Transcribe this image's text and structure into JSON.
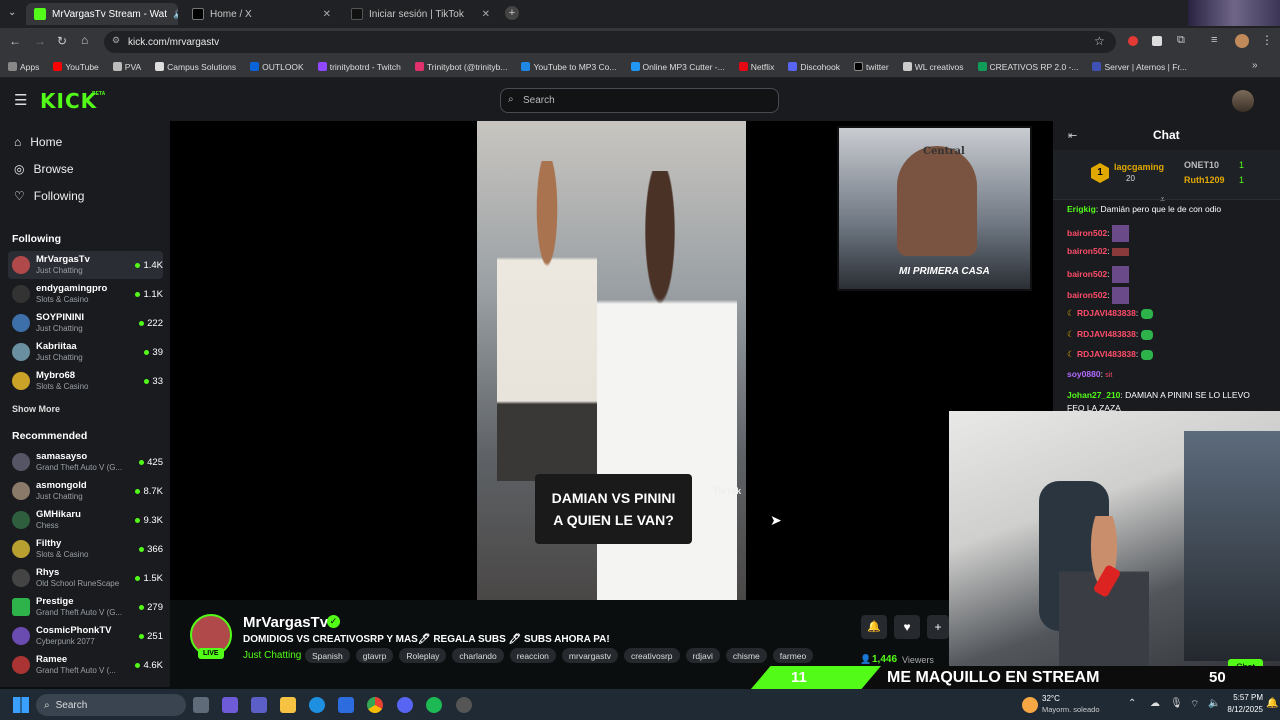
{
  "browser": {
    "tabs": [
      {
        "title": "MrVargasTv Stream - Wat",
        "active": true
      },
      {
        "title": "Home / X",
        "active": false
      },
      {
        "title": "Iniciar sesión | TikTok",
        "active": false
      }
    ],
    "url": "kick.com/mrvargastv",
    "bookmarks": [
      "Apps",
      "YouTube",
      "PVA",
      "Campus Solutions",
      "OUTLOOK",
      "trinitybotrd - Twitch",
      "Trinitybot (@trinityb...",
      "YouTube to MP3 Co...",
      "Online MP3 Cutter -...",
      "Netflix",
      "Discohook",
      "twitter",
      "WL creativos",
      "CREATIVOS RP 2.0 -...",
      "Server | Aternos | Fr..."
    ]
  },
  "header": {
    "logo": "KICK",
    "logo_tag": "BETA",
    "search_placeholder": "Search"
  },
  "sidebar": {
    "nav": [
      "Home",
      "Browse",
      "Following"
    ],
    "following_title": "Following",
    "following": [
      {
        "name": "MrVargasTv",
        "category": "Just Chatting",
        "viewers": "1.4K"
      },
      {
        "name": "endygamingpro",
        "category": "Slots & Casino",
        "viewers": "1.1K"
      },
      {
        "name": "SOYPININI",
        "category": "Just Chatting",
        "viewers": "222"
      },
      {
        "name": "Kabriitaa",
        "category": "Just Chatting",
        "viewers": "39"
      },
      {
        "name": "Mybro68",
        "category": "Slots & Casino",
        "viewers": "33"
      }
    ],
    "show_more": "Show More",
    "recommended_title": "Recommended",
    "recommended": [
      {
        "name": "samasayso",
        "category": "Grand Theft Auto V (G...",
        "viewers": "425"
      },
      {
        "name": "asmongold",
        "category": "Just Chatting",
        "viewers": "8.7K"
      },
      {
        "name": "GMHikaru",
        "category": "Chess",
        "viewers": "9.3K"
      },
      {
        "name": "Filthy",
        "category": "Slots & Casino",
        "viewers": "366"
      },
      {
        "name": "Rhys",
        "category": "Old School RuneScape",
        "viewers": "1.5K"
      },
      {
        "name": "Prestige",
        "category": "Grand Theft Auto V (G...",
        "viewers": "279"
      },
      {
        "name": "CosmicPhonkTV",
        "category": "Cyberpunk 2077",
        "viewers": "251"
      },
      {
        "name": "Ramee",
        "category": "Grand Theft Auto V (...",
        "viewers": "4.6K"
      }
    ]
  },
  "video": {
    "caption_line1": "DAMIAN VS PININI",
    "caption_line2": "A QUIEN LE VAN?",
    "watermark": "TikTok",
    "cam_sign": "Central",
    "cam_banner": "MI PRIMERA CASA"
  },
  "stream": {
    "streamer": "MrVargasTv",
    "live_badge": "LIVE",
    "title": "DOMIDIOS VS CREATIVOSRP Y MAS🖊 REGALA SUBS 🖊 SUBS AHORA PA!",
    "category": "Just Chatting",
    "tags": [
      "Spanish",
      "gtavrp",
      "Roleplay",
      "charlando",
      "reaccion",
      "mrvargastv",
      "creativosrp",
      "rdjavi",
      "chisme",
      "farmeo"
    ],
    "viewers": "1,446",
    "viewers_label": "Viewers"
  },
  "chat": {
    "title": "Chat",
    "top_gifter": {
      "rank": "1",
      "name": "lagcgaming",
      "count": "20"
    },
    "leaders": [
      {
        "name": "ONET10",
        "count": "1"
      },
      {
        "name": "Ruth1209",
        "count": "1"
      }
    ],
    "messages": [
      {
        "user": "Erigkig",
        "text": "Damián pero que le de con odio",
        "color": "#53fc18"
      },
      {
        "user": "bairon502",
        "text": "",
        "color": "#ff4d6a"
      },
      {
        "user": "bairon502",
        "text": "",
        "color": "#ff4d6a"
      },
      {
        "user": "bairon502",
        "text": "",
        "color": "#ff4d6a"
      },
      {
        "user": "bairon502",
        "text": "",
        "color": "#ff4d6a"
      },
      {
        "user": "RDJAVI483838",
        "text": "",
        "color": "#ff4d6a"
      },
      {
        "user": "RDJAVI483838",
        "text": "",
        "color": "#ff4d6a"
      },
      {
        "user": "RDJAVI483838",
        "text": "",
        "color": "#ff4d6a"
      },
      {
        "user": "soy0880",
        "text": "sit",
        "color": "#b36bff"
      },
      {
        "user": "Johan27_210",
        "text": "DAMIAN A PININI SE LO LLEVO",
        "color": "#53fc18"
      }
    ],
    "msg_cont": "FEO LA ZAZA",
    "chat_button": "Chat"
  },
  "overlay": {
    "left_num": "11",
    "text": "ME MAQUILLO EN STREAM",
    "right_num": "50"
  },
  "taskbar": {
    "search": "Search",
    "weather_temp": "32°C",
    "weather_desc": "Mayorm. soleado",
    "time": "5:57 PM",
    "date": "8/12/2025"
  }
}
